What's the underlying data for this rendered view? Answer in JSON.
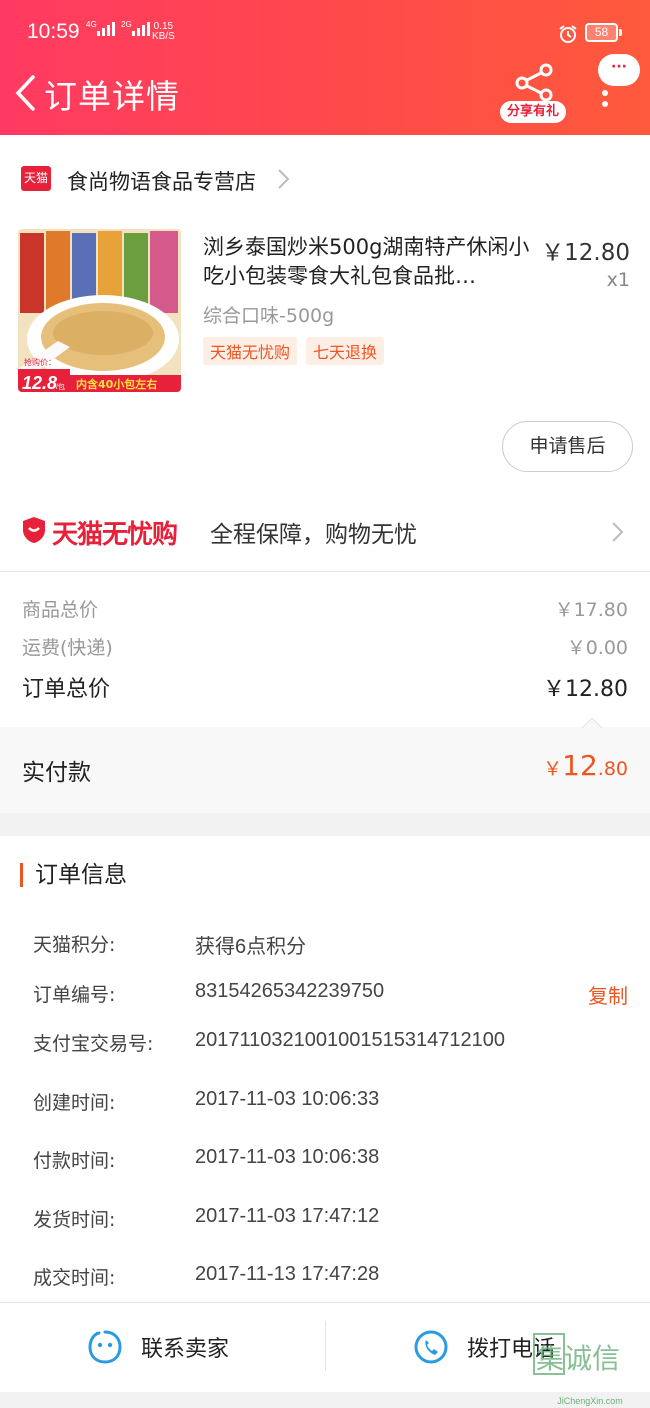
{
  "status_bar": {
    "time": "10:59",
    "network_1": "4G",
    "network_2": "2G",
    "speed_value": "0.15",
    "speed_unit": "KB/S",
    "battery": "58"
  },
  "nav": {
    "title": "订单详情",
    "share_label": "分享有礼",
    "more_label": "···"
  },
  "shop": {
    "badge": "天猫",
    "name": "食尚物语食品专营店"
  },
  "product": {
    "title": "浏乡泰国炒米500g湖南特产休闲小吃小包装零食大礼包食品批…",
    "price": "￥12.80",
    "quantity": "x1",
    "sku": "综合口味-500g",
    "tags": [
      "天猫无忧购",
      "七天退换"
    ],
    "thumb_price_label": "抢购价：",
    "thumb_price": "12.8",
    "thumb_unit": "/包",
    "thumb_caption": "内含40小包左右"
  },
  "after_sale_label": "申请售后",
  "guarantee": {
    "brand": "天猫无忧购",
    "text": "全程保障，购物无忧"
  },
  "prices": {
    "goods_label": "商品总价",
    "goods_value": "￥17.80",
    "freight_label": "运费(快递)",
    "freight_value": "￥0.00",
    "total_label": "订单总价",
    "total_value": "￥12.80",
    "paid_label": "实付款",
    "paid_currency": "￥",
    "paid_int": "12",
    "paid_dec": ".80"
  },
  "order_info": {
    "title": "订单信息",
    "rows": [
      {
        "key": "天猫积分:",
        "value": "获得6点积分"
      },
      {
        "key": "订单编号:",
        "value": "83154265342239750"
      },
      {
        "key": "支付宝交易号:",
        "value": "2017110321001001515314712100"
      },
      {
        "key": "创建时间:",
        "value": "2017-11-03 10:06:33"
      },
      {
        "key": "付款时间:",
        "value": "2017-11-03 10:06:38"
      },
      {
        "key": "发货时间:",
        "value": "2017-11-03 17:47:12"
      },
      {
        "key": "成交时间:",
        "value": "2017-11-13 17:47:28"
      }
    ],
    "copy_label": "复制"
  },
  "bottom": {
    "contact_label": "联系卖家",
    "call_label": "拨打电话"
  },
  "watermark": {
    "text": "集诚信",
    "url": "JiChengXin.com"
  },
  "colors": {
    "brand_red": "#e8213a",
    "accent_orange": "#ee5522",
    "icon_blue": "#2a9be0"
  }
}
